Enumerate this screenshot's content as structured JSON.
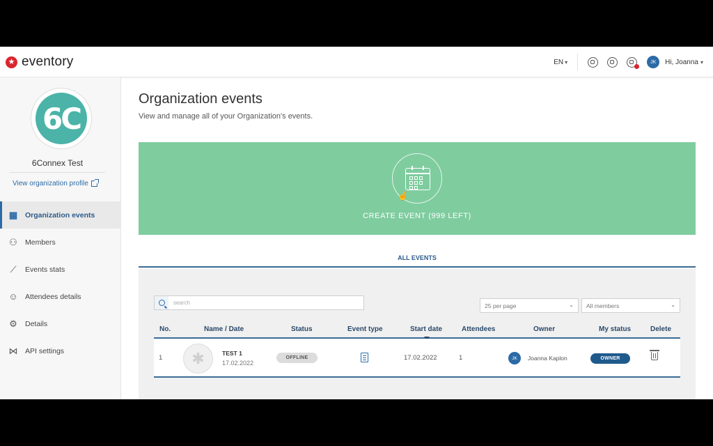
{
  "app": {
    "logo_text": "eventory",
    "language": "EN",
    "greeting": "Hi, Joanna",
    "user_initials": "JK"
  },
  "sidebar": {
    "org_logo_text": "6C",
    "org_name": "6Connex Test",
    "view_profile_label": "View organization profile",
    "items": [
      {
        "label": "Organization events",
        "icon": "calendar-icon",
        "active": true
      },
      {
        "label": "Members",
        "icon": "members-icon",
        "active": false
      },
      {
        "label": "Events stats",
        "icon": "chart-line-icon",
        "active": false
      },
      {
        "label": "Attendees details",
        "icon": "attendees-icon",
        "active": false
      },
      {
        "label": "Details",
        "icon": "gear-icon",
        "active": false
      },
      {
        "label": "API settings",
        "icon": "share-icon",
        "active": false
      }
    ]
  },
  "main": {
    "title": "Organization events",
    "subtitle": "View and manage all of your Organization's events.",
    "create_label": "CREATE EVENT (999 LEFT)",
    "tab_label": "ALL EVENTS",
    "search_placeholder": "search",
    "per_page": "25 per page",
    "members_filter": "All members"
  },
  "table": {
    "headers": [
      "No.",
      "Name / Date",
      "Status",
      "Event type",
      "Start date",
      "Attendees",
      "Owner",
      "My status",
      "Delete"
    ],
    "rows": [
      {
        "no": "1",
        "name": "TEST 1",
        "date": "17.02.2022",
        "status": "OFFLINE",
        "start_date": "17.02.2022",
        "attendees": "1",
        "owner_initials": "JK",
        "owner": "Joanna Kaplon",
        "my_status": "OWNER"
      }
    ]
  },
  "colors": {
    "accent": "#2b6aa6",
    "banner": "#7fcc9f",
    "logo_red": "#d9262e",
    "org_teal": "#4bb3a8"
  }
}
